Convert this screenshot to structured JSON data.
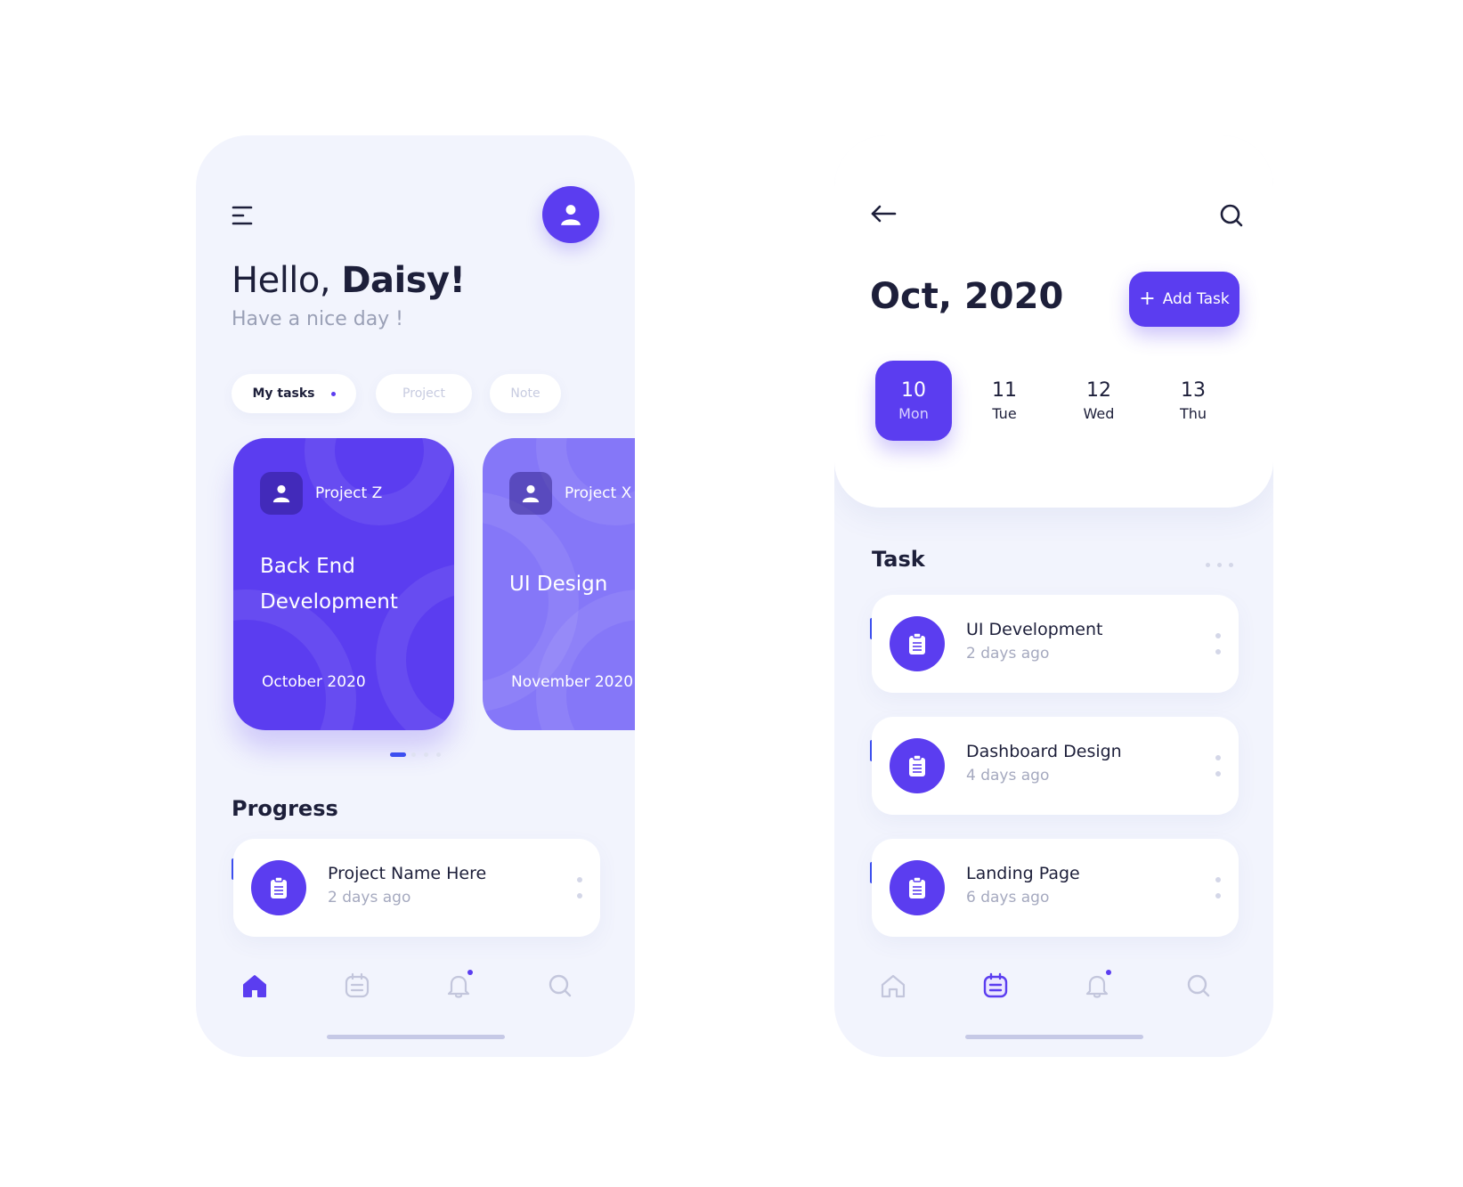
{
  "colors": {
    "accent": "#5b3df0",
    "accent_light": "#8577f8",
    "text_dark": "#1d1f3a",
    "text_muted": "#a5a9bf",
    "phone_bg": "#f2f4fd",
    "card_bg": "#ffffff"
  },
  "home": {
    "greeting_prefix": "Hello, ",
    "greeting_name": "Daisy!",
    "subgreeting": "Have a nice day !",
    "chips": [
      "My tasks",
      "Project",
      "Note"
    ],
    "projects": [
      {
        "label": "Project Z",
        "title": "Back End Development",
        "date": "October 2020"
      },
      {
        "label": "Project X",
        "title": "UI Design",
        "date": "November 2020"
      }
    ],
    "progress_title": "Progress",
    "progress_item": {
      "name": "Project Name Here",
      "time": "2 days ago"
    },
    "icons": {
      "menu": "menu-icon",
      "avatar": "user-icon",
      "project": "user-icon",
      "task": "clipboard-icon",
      "tabs": [
        "home-icon",
        "calendar-icon",
        "bell-icon",
        "search-icon"
      ]
    }
  },
  "calendar": {
    "month_title": "Oct, 2020",
    "add_task_label": "Add Task",
    "days": [
      {
        "num": "10",
        "name": "Mon"
      },
      {
        "num": "11",
        "name": "Tue"
      },
      {
        "num": "12",
        "name": "Wed"
      },
      {
        "num": "13",
        "name": "Thu"
      }
    ],
    "task_title": "Task",
    "tasks": [
      {
        "name": "UI Development",
        "time": "2 days ago"
      },
      {
        "name": "Dashboard Design",
        "time": "4 days ago"
      },
      {
        "name": "Landing Page",
        "time": "6 days ago"
      }
    ],
    "icons": {
      "back": "arrow-left-icon",
      "search": "search-icon",
      "add": "plus-icon",
      "tabs": [
        "home-icon",
        "calendar-icon",
        "bell-icon",
        "search-icon"
      ]
    }
  }
}
